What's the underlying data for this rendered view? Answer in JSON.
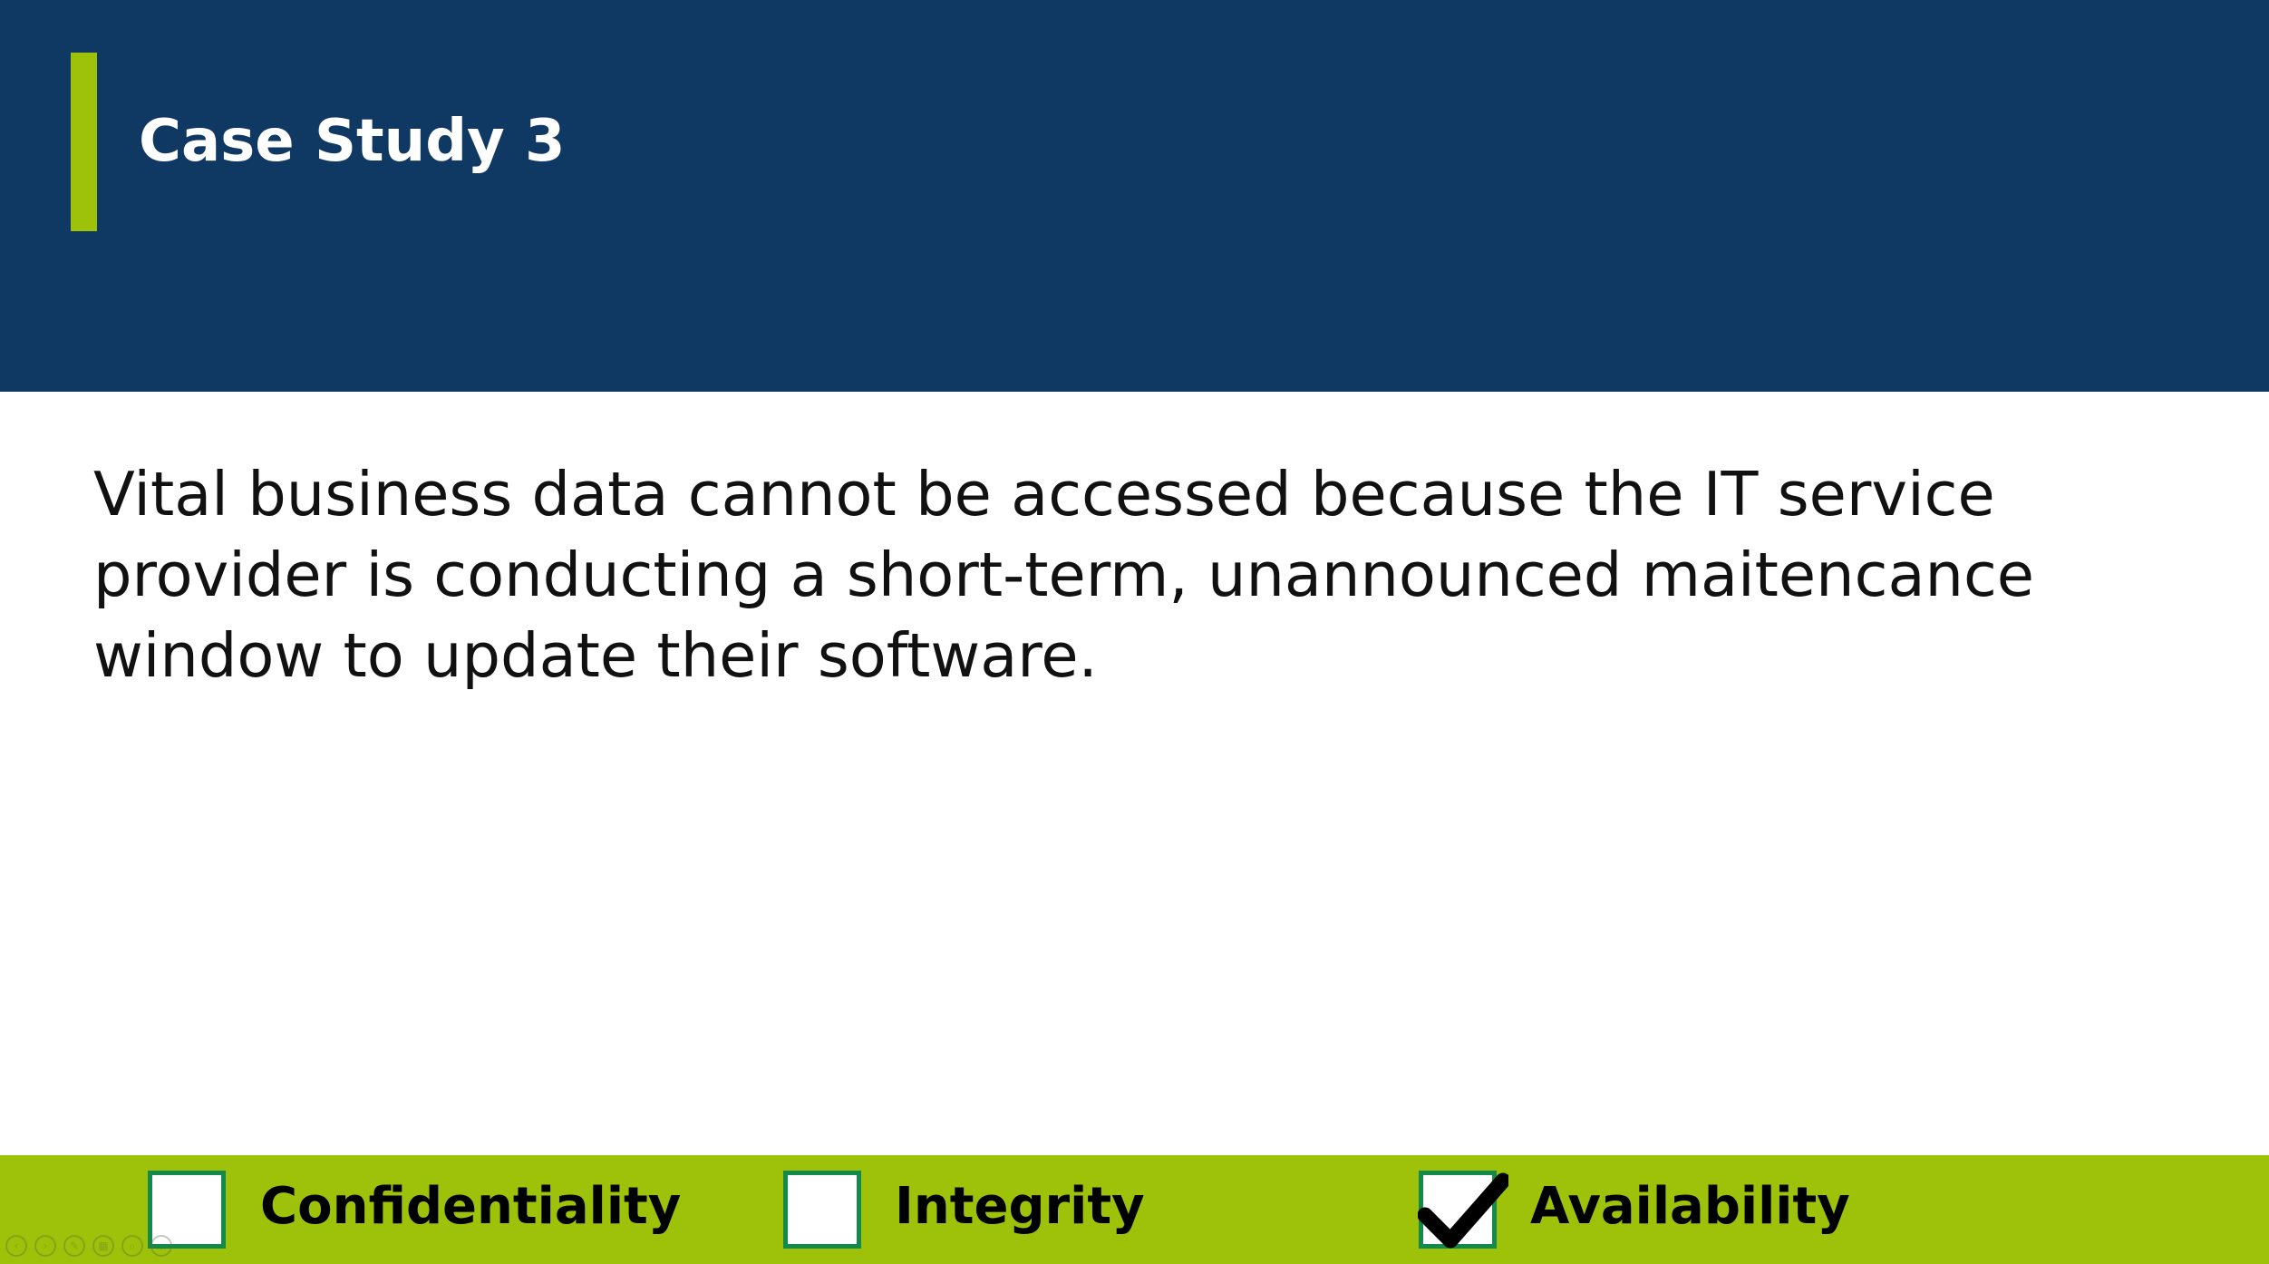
{
  "slide": {
    "title": "Case Study 3",
    "body": "Vital business data cannot be accessed because the IT service provider is conducting a short-term, unannounced maitencance window to update their software."
  },
  "cia_options": [
    {
      "label": "Confidentiality",
      "checked": false
    },
    {
      "label": "Integrity",
      "checked": false
    },
    {
      "label": "Availability",
      "checked": true
    }
  ],
  "presenter_controls": {
    "icons": [
      "previous-slide-icon",
      "next-slide-icon",
      "pen-icon",
      "slides-grid-icon",
      "zoom-icon",
      "more-options-icon"
    ],
    "glyphs": [
      "‹",
      "›",
      "✎",
      "▦",
      "⌕",
      "…"
    ]
  },
  "colors": {
    "header_bg": "#0f3862",
    "accent": "#9dc209",
    "footer_bg": "#9dc209",
    "checkbox_border": "#138a4c",
    "title_text": "#ffffff",
    "body_text": "#111111"
  }
}
